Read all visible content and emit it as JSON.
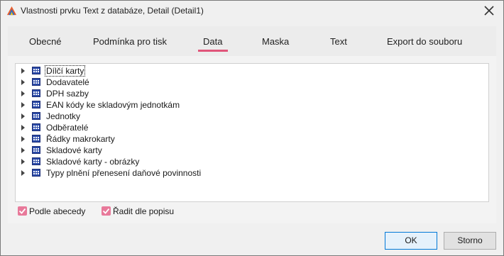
{
  "window": {
    "title": "Vlastnosti prvku Text z databáze, Detail (Detail1)",
    "accent_color": "#e0557a"
  },
  "tabs": [
    {
      "label": "Obecné",
      "active": false
    },
    {
      "label": "Podmínka pro tisk",
      "active": false
    },
    {
      "label": "Data",
      "active": true
    },
    {
      "label": "Maska",
      "active": false
    },
    {
      "label": "Text",
      "active": false
    },
    {
      "label": "Export do souboru",
      "active": false
    }
  ],
  "tree": {
    "items": [
      {
        "label": "Dílčí karty",
        "selected": true,
        "icon": "table-icon"
      },
      {
        "label": "Dodavatelé",
        "selected": false,
        "icon": "table-icon"
      },
      {
        "label": "DPH sazby",
        "selected": false,
        "icon": "table-icon"
      },
      {
        "label": "EAN kódy ke skladovým jednotkám",
        "selected": false,
        "icon": "table-icon"
      },
      {
        "label": "Jednotky",
        "selected": false,
        "icon": "table-icon"
      },
      {
        "label": "Odběratelé",
        "selected": false,
        "icon": "table-icon"
      },
      {
        "label": "Řádky makrokarty",
        "selected": false,
        "icon": "table-icon"
      },
      {
        "label": "Skladové karty",
        "selected": false,
        "icon": "table-icon"
      },
      {
        "label": "Skladové karty - obrázky",
        "selected": false,
        "icon": "table-icon"
      },
      {
        "label": "Typy plnění přenesení daňové povinnosti",
        "selected": false,
        "icon": "table-icon"
      }
    ]
  },
  "options": {
    "alphabetical_label": "Podle abecedy",
    "alphabetical_checked": true,
    "sort_by_description_label": "Řadit dle popisu",
    "sort_by_description_checked": true
  },
  "buttons": {
    "ok_label": "OK",
    "cancel_label": "Storno"
  }
}
